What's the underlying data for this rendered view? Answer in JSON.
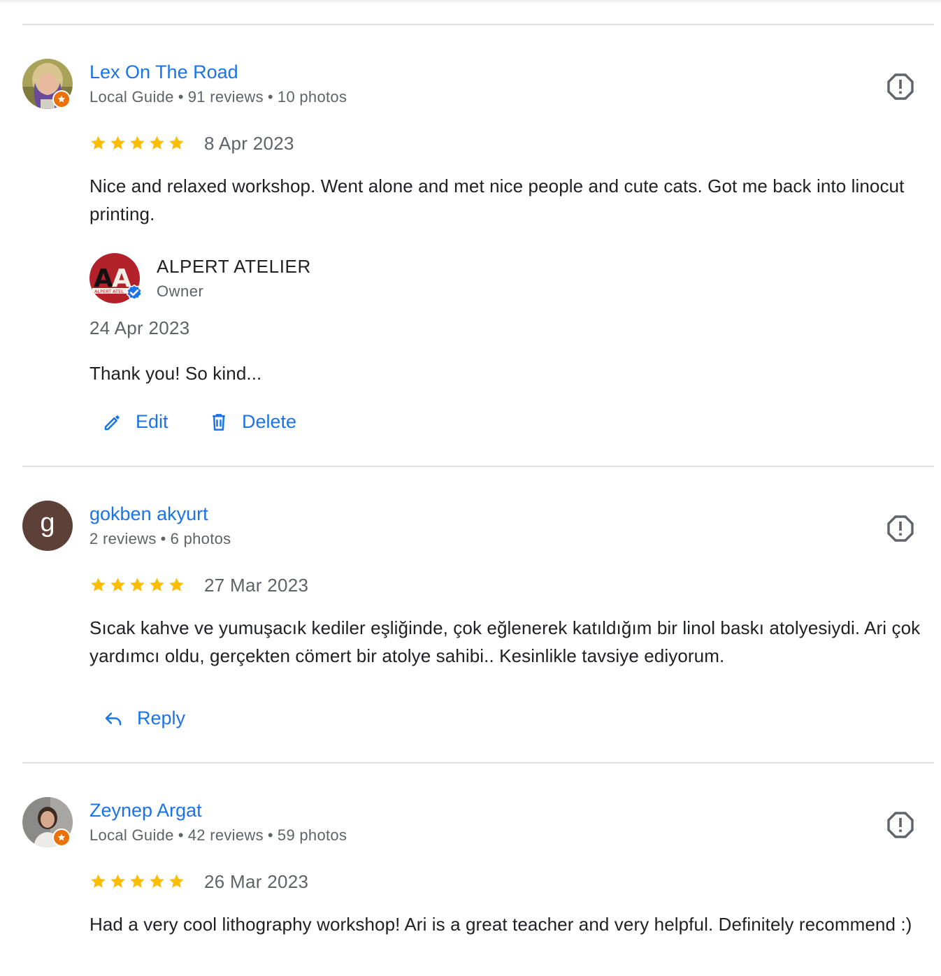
{
  "colors": {
    "link_blue": "#1a73e8",
    "star_yellow": "#fbbc04",
    "guide_orange": "#e8710a",
    "muted_text": "#5f6368",
    "divider": "#e2e2e2"
  },
  "reviews": [
    {
      "author": "Lex On The Road",
      "local_guide_label": "Local Guide",
      "reviews_count": "91 reviews",
      "photos_count": "10 photos",
      "rating": 5,
      "date": "8 Apr 2023",
      "text": "Nice and relaxed workshop. Went alone and met nice people and cute cats. Got me back into linocut printing.",
      "owner_reply": {
        "name": "ALPERT ATELIER",
        "role": "Owner",
        "date": "24 Apr 2023",
        "text": "Thank you! So kind...",
        "edit_label": "Edit",
        "delete_label": "Delete"
      }
    },
    {
      "author": "gokben akyurt",
      "avatar_letter": "g",
      "reviews_count": "2 reviews",
      "photos_count": "6 photos",
      "rating": 5,
      "date": "27 Mar 2023",
      "text": "Sıcak kahve ve yumuşacık kediler eşliğinde, çok eğlenerek katıldığım bir linol baskı atolyesiydi. Ari çok yardımcı oldu, gerçekten cömert bir atolye sahibi.. Kesinlikle tavsiye ediyorum.",
      "reply_label": "Reply"
    },
    {
      "author": "Zeynep Argat",
      "local_guide_label": "Local Guide",
      "reviews_count": "42 reviews",
      "photos_count": "59 photos",
      "rating": 5,
      "date": "26 Mar 2023",
      "text": "Had a very cool lithography workshop! Ari is a great teacher and very helpful. Definitely recommend :)"
    }
  ]
}
